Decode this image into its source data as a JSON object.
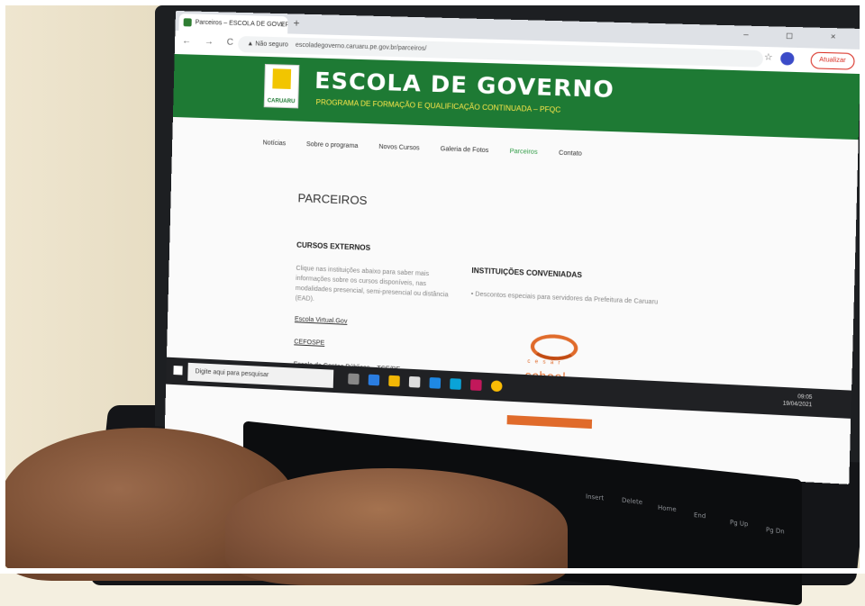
{
  "browser": {
    "tab_title": "Parceiros – ESCOLA DE GOVERNO",
    "tab_close": "×",
    "new_tab": "+",
    "window_controls": "– ◻ ×",
    "nav_icons": "← → C ⌂",
    "url_warning": "▲ Não seguro",
    "url": "escoladegoverno.caruaru.pe.gov.br/parceiros/",
    "star": "☆",
    "update_button": "Atualizar"
  },
  "site": {
    "logo_text": "CARUARU",
    "title": "ESCOLA DE GOVERNO",
    "subtitle": "PROGRAMA DE FORMAÇÃO E QUALIFICAÇÃO CONTINUADA – PFQC",
    "nav": [
      "Notícias",
      "Sobre o programa",
      "Novos Cursos",
      "Galeria de Fotos",
      "Parceiros",
      "Contato"
    ],
    "nav_active": "Parceiros"
  },
  "content": {
    "page_title": "PARCEIROS",
    "left": {
      "heading": "CURSOS EXTERNOS",
      "paragraph": "Clique nas instituições abaixo para saber mais informações sobre os cursos disponíveis, nas modalidades presencial, semi-presencial ou distância (EAD).",
      "links": [
        "Escola Virtual.Gov",
        "CEFOSPE",
        "Escola de Contas Públicas – TCE/PE"
      ]
    },
    "right": {
      "heading": "INSTITUIÇÕES CONVENIADAS",
      "bullet": "Descontos especiais para servidores da Prefeitura de Caruaru",
      "partner_letters": "cesar",
      "partner_name": "school"
    }
  },
  "taskbar": {
    "search_placeholder": "Digite aqui para pesquisar",
    "time": "09:05",
    "date": "19/04/2021"
  },
  "keyboard": {
    "keys": [
      "Insert",
      "Delete",
      "Home",
      "End",
      "Pg Up",
      "Pg Dn"
    ]
  },
  "colors": {
    "header_green": "#1e7a34",
    "subtitle_yellow": "#ffe84a",
    "active_nav": "#2e9b44",
    "partner_orange": "#e06b2b"
  }
}
